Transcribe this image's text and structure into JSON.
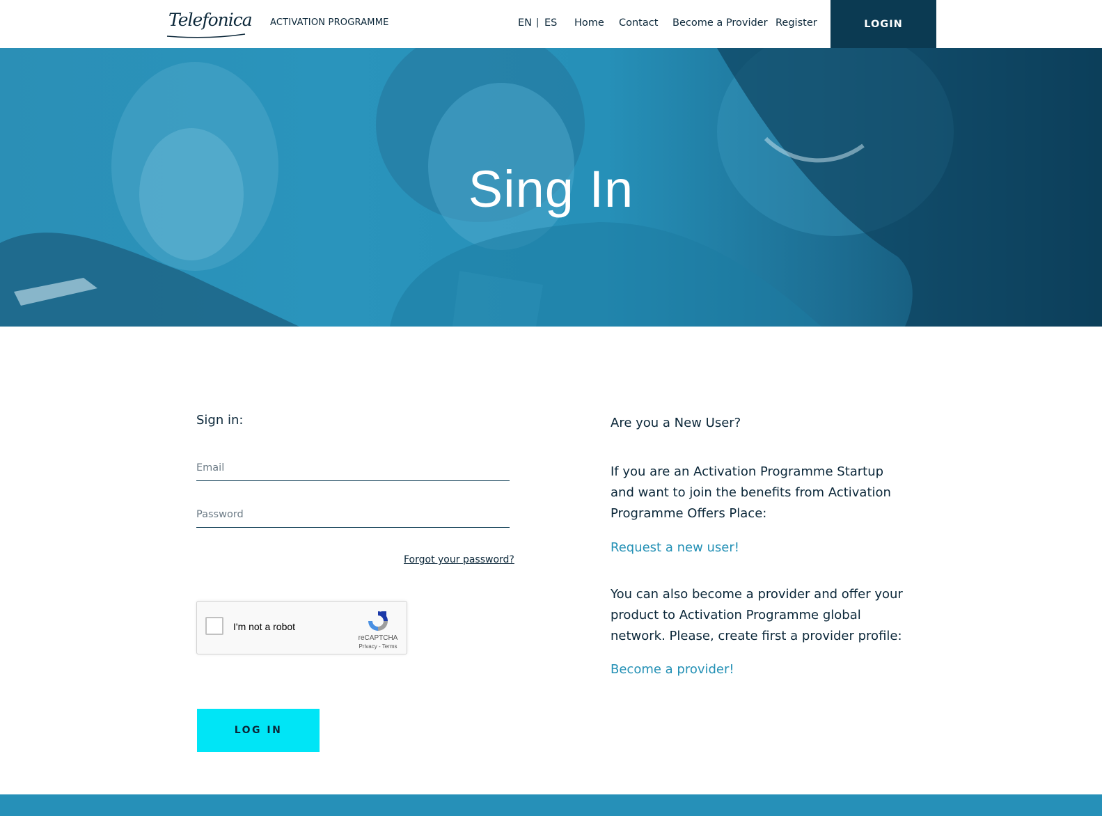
{
  "header": {
    "brand": "Telefonica",
    "programme": "ACTIVATION PROGRAMME",
    "lang_en": "EN",
    "lang_sep": "|",
    "lang_es": "ES",
    "nav": {
      "home": "Home",
      "contact": "Contact",
      "provider": "Become a Provider",
      "register": "Register"
    },
    "login": "LOGIN"
  },
  "hero": {
    "title": "Sing In"
  },
  "form": {
    "title": "Sign in:",
    "email_placeholder": "Email",
    "password_placeholder": "Password",
    "forgot": "Forgot your password?",
    "submit": "LOG IN"
  },
  "captcha": {
    "label": "I'm not a robot",
    "brand": "reCAPTCHA",
    "links": "Privacy - Terms"
  },
  "newuser": {
    "heading": "Are you a New User?",
    "text1": "If you are an Activation Programme Startup and want to join the benefits from Activation Programme Offers Place:",
    "link1": "Request a new user!",
    "text2": "You can also become a provider and offer your product to Activation Programme global network. Please, create first a provider profile:",
    "link2": "Become a provider!"
  },
  "colors": {
    "navy": "#0b3a52",
    "cyan_button": "#00e5f6",
    "link_blue": "#2390b5",
    "hero_blue": "#2690b8"
  }
}
